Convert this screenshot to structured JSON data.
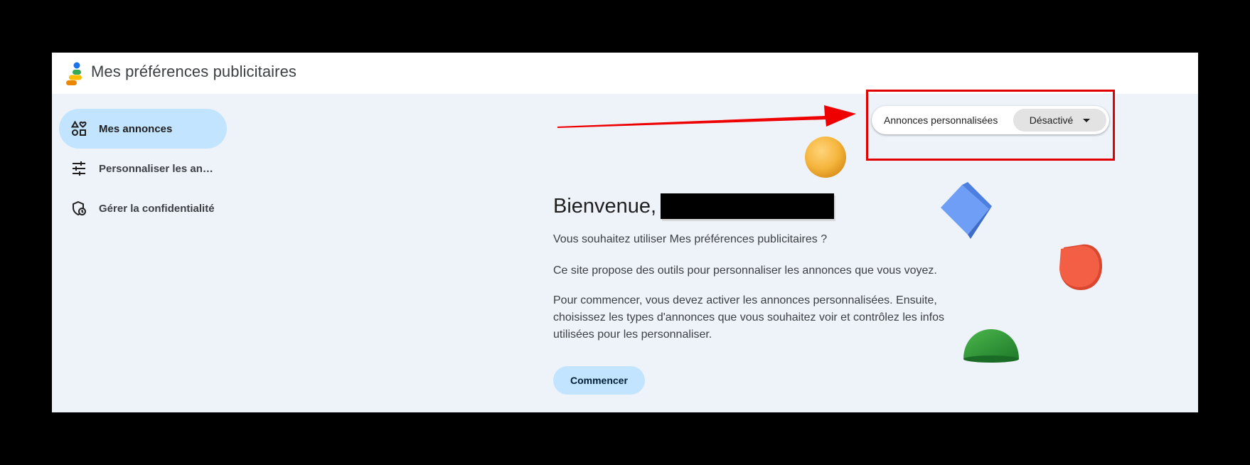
{
  "app": {
    "title": "Mes préférences publicitaires"
  },
  "sidebar": {
    "items": [
      {
        "label": "Mes annonces",
        "icon": "shapes-icon",
        "active": true
      },
      {
        "label": "Personnaliser les annonces",
        "icon": "tune-icon",
        "active": false
      },
      {
        "label": "Gérer la confidentialité",
        "icon": "privacy-shield-icon",
        "active": false
      }
    ]
  },
  "personalized_ads": {
    "label": "Annonces personnalisées",
    "value": "Désactivé"
  },
  "main": {
    "welcome": "Bienvenue,",
    "question": "Vous souhaitez utiliser Mes préférences publicitaires ?",
    "intro": "Ce site propose des outils pour personnaliser les annonces que vous voyez.",
    "instructions": "Pour commencer, vous devez activer les annonces personnalisées. Ensuite, choisissez les types d'annonces que vous souhaitez voir et contrôlez les infos utilisées pour les personnaliser.",
    "start_button": "Commencer"
  },
  "colors": {
    "accent": "#c2e4ff",
    "background": "#eef3fa",
    "annotation": "#e00000"
  }
}
